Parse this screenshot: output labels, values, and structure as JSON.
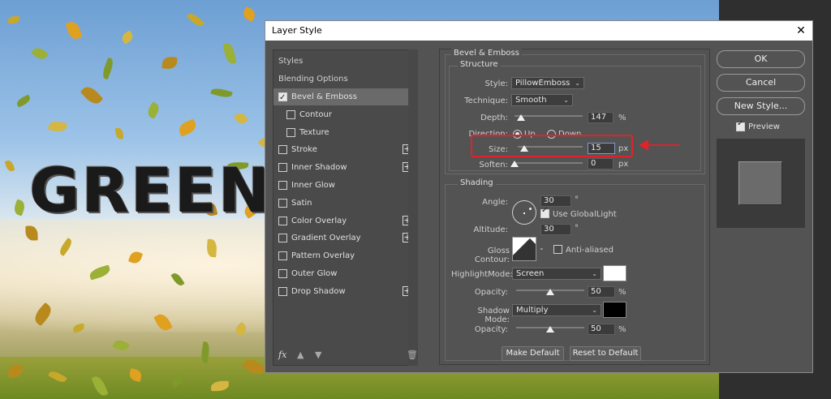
{
  "background": {
    "image_text": "GREEN"
  },
  "dialog": {
    "title": "Layer Style",
    "close_glyph": "✕"
  },
  "styles_list": {
    "header": "Styles",
    "blending_options": "Blending Options",
    "items": [
      {
        "label": "Bevel & Emboss",
        "checked": true,
        "selected": true,
        "indent": false,
        "has_plus": false
      },
      {
        "label": "Contour",
        "checked": false,
        "selected": false,
        "indent": true,
        "has_plus": false
      },
      {
        "label": "Texture",
        "checked": false,
        "selected": false,
        "indent": true,
        "has_plus": false
      },
      {
        "label": "Stroke",
        "checked": false,
        "selected": false,
        "indent": false,
        "has_plus": true
      },
      {
        "label": "Inner Shadow",
        "checked": false,
        "selected": false,
        "indent": false,
        "has_plus": true
      },
      {
        "label": "Inner Glow",
        "checked": false,
        "selected": false,
        "indent": false,
        "has_plus": false
      },
      {
        "label": "Satin",
        "checked": false,
        "selected": false,
        "indent": false,
        "has_plus": false
      },
      {
        "label": "Color Overlay",
        "checked": false,
        "selected": false,
        "indent": false,
        "has_plus": true
      },
      {
        "label": "Gradient Overlay",
        "checked": false,
        "selected": false,
        "indent": false,
        "has_plus": true
      },
      {
        "label": "Pattern Overlay",
        "checked": false,
        "selected": false,
        "indent": false,
        "has_plus": false
      },
      {
        "label": "Outer Glow",
        "checked": false,
        "selected": false,
        "indent": false,
        "has_plus": false
      },
      {
        "label": "Drop Shadow",
        "checked": false,
        "selected": false,
        "indent": false,
        "has_plus": true
      }
    ],
    "footer": {
      "fx_label": "fx",
      "up_icon": "arrow-up-icon",
      "down_icon": "arrow-down-icon",
      "trash_icon": "trash-icon"
    }
  },
  "bevel": {
    "section_title": "Bevel & Emboss",
    "structure": {
      "title": "Structure",
      "style_label": "Style:",
      "style_value": "PillowEmboss",
      "technique_label": "Technique:",
      "technique_value": "Smooth",
      "depth_label": "Depth:",
      "depth_value": "147",
      "depth_unit": "%",
      "depth_fraction": 0.1,
      "direction_label": "Direction:",
      "direction_up": "Up",
      "direction_down": "Down",
      "direction_selected": "Up",
      "size_label": "Size:",
      "size_value": "15",
      "size_unit": "px",
      "size_fraction": 0.1,
      "soften_label": "Soften:",
      "soften_value": "0",
      "soften_unit": "px",
      "soften_fraction": 0.0
    },
    "shading": {
      "title": "Shading",
      "angle_label": "Angle:",
      "angle_value": "30",
      "angle_unit": "°",
      "use_global_light_label": "Use GlobalLight",
      "use_global_light_checked": true,
      "altitude_label": "Altitude:",
      "altitude_value": "30",
      "altitude_unit": "°",
      "gloss_contour_label": "Gloss Contour:",
      "anti_aliased_label": "Anti-aliased",
      "anti_aliased_checked": false,
      "highlight_mode_label": "HighlightMode:",
      "highlight_mode_value": "Screen",
      "highlight_color": "#ffffff",
      "highlight_opacity_label": "Opacity:",
      "highlight_opacity_value": "50",
      "highlight_opacity_unit": "%",
      "highlight_opacity_fraction": 0.5,
      "shadow_mode_label": "Shadow Mode:",
      "shadow_mode_value": "Multiply",
      "shadow_color": "#000000",
      "shadow_opacity_label": "Opacity:",
      "shadow_opacity_value": "50",
      "shadow_opacity_unit": "%",
      "shadow_opacity_fraction": 0.5
    },
    "make_default_label": "Make Default",
    "reset_default_label": "Reset to Default"
  },
  "side_buttons": {
    "ok_label": "OK",
    "cancel_label": "Cancel",
    "new_style_label": "New Style...",
    "preview_label": "Preview",
    "preview_checked": true
  },
  "colors": {
    "annotation_red": "#e0232b",
    "dialog_bg": "#535353"
  }
}
